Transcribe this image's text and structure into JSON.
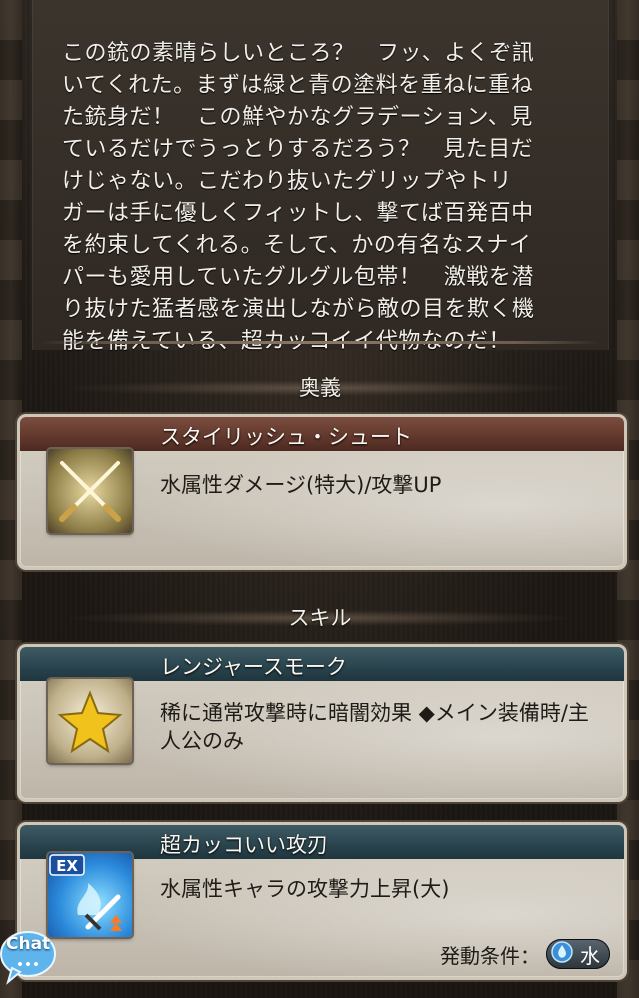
{
  "description": {
    "lines": [
      "この銃の素晴らしいところ？　フッ、よくぞ訊",
      "いてくれた。まずは緑と青の塗料を重ねに重ね",
      "た銃身だ！　この鮮やかなグラデーション、見",
      "ているだけでうっとりするだろう？　見た目だ",
      "けじゃない。こだわり抜いたグリップやトリ",
      "ガーは手に優しくフィットし、撃てば百発百中",
      "を約束してくれる。そして、かの有名なスナイ",
      "パーも愛用していたグルグル包帯！　激戦を潜",
      "り抜けた猛者感を演出しながら敵の目を欺く機",
      "能を備えている、超カッコイイ代物なのだ！"
    ]
  },
  "ougi": {
    "heading": "奥義",
    "name": "スタイリッシュ・シュート",
    "effect": "水属性ダメージ(特大)/攻撃UP",
    "icon": "crossed-swords-icon"
  },
  "skills": {
    "heading": "スキル",
    "items": [
      {
        "name": "レンジャースモーク",
        "effect": "稀に通常攻撃時に暗闇効果 ◆メイン装備時/主人公のみ",
        "icon": "gold-star-icon"
      },
      {
        "name": "超カッコいい攻刃",
        "effect": "水属性キャラの攻撃力上昇(大)",
        "icon": "ex-water-sword-icon",
        "icon_text": "EX",
        "condition_label": "発動条件：",
        "condition_value": "水"
      }
    ]
  },
  "chat": {
    "label": "Chat"
  },
  "colors": {
    "ougi_header": "#5d3429",
    "skill_header": "#26404a",
    "card_bg": "#c9c2b6",
    "water": "#3a8fd8"
  }
}
